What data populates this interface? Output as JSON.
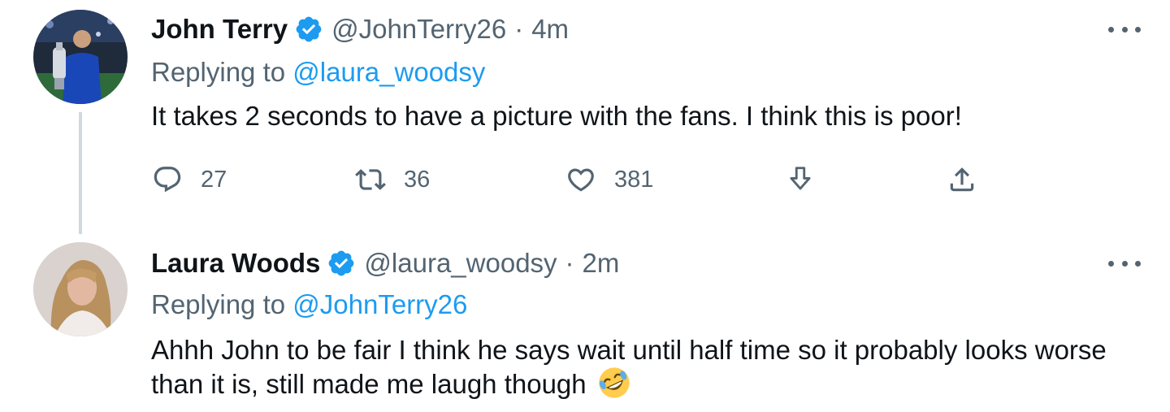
{
  "tweets": [
    {
      "author_name": "John Terry",
      "handle": "@JohnTerry26",
      "separator": "·",
      "time": "4m",
      "replying_prefix": "Replying to",
      "replying_to": "@laura_woodsy",
      "text": "It takes 2 seconds to have a picture with the fans. I think this is poor!",
      "actions": {
        "reply_count": "27",
        "retweet_count": "36",
        "like_count": "381"
      }
    },
    {
      "author_name": "Laura Woods",
      "handle": "@laura_woodsy",
      "separator": "·",
      "time": "2m",
      "replying_prefix": "Replying to",
      "replying_to": "@JohnTerry26",
      "text": "Ahhh John to be fair I think he says wait until half time so it probably looks worse than it is, still made me laugh though"
    }
  ],
  "icons": {
    "verified": "verified-badge-icon",
    "more": "more-options-icon",
    "reply": "reply-icon",
    "retweet": "retweet-icon",
    "like": "heart-icon",
    "download": "download-icon",
    "share": "share-icon",
    "emoji": "rolling-on-floor-laughing-emoji"
  },
  "colors": {
    "text": "#0f1419",
    "secondary": "#536471",
    "accent": "#1d9bf0",
    "thread_line": "#cfd9de",
    "verified": "#1d9bf0"
  }
}
